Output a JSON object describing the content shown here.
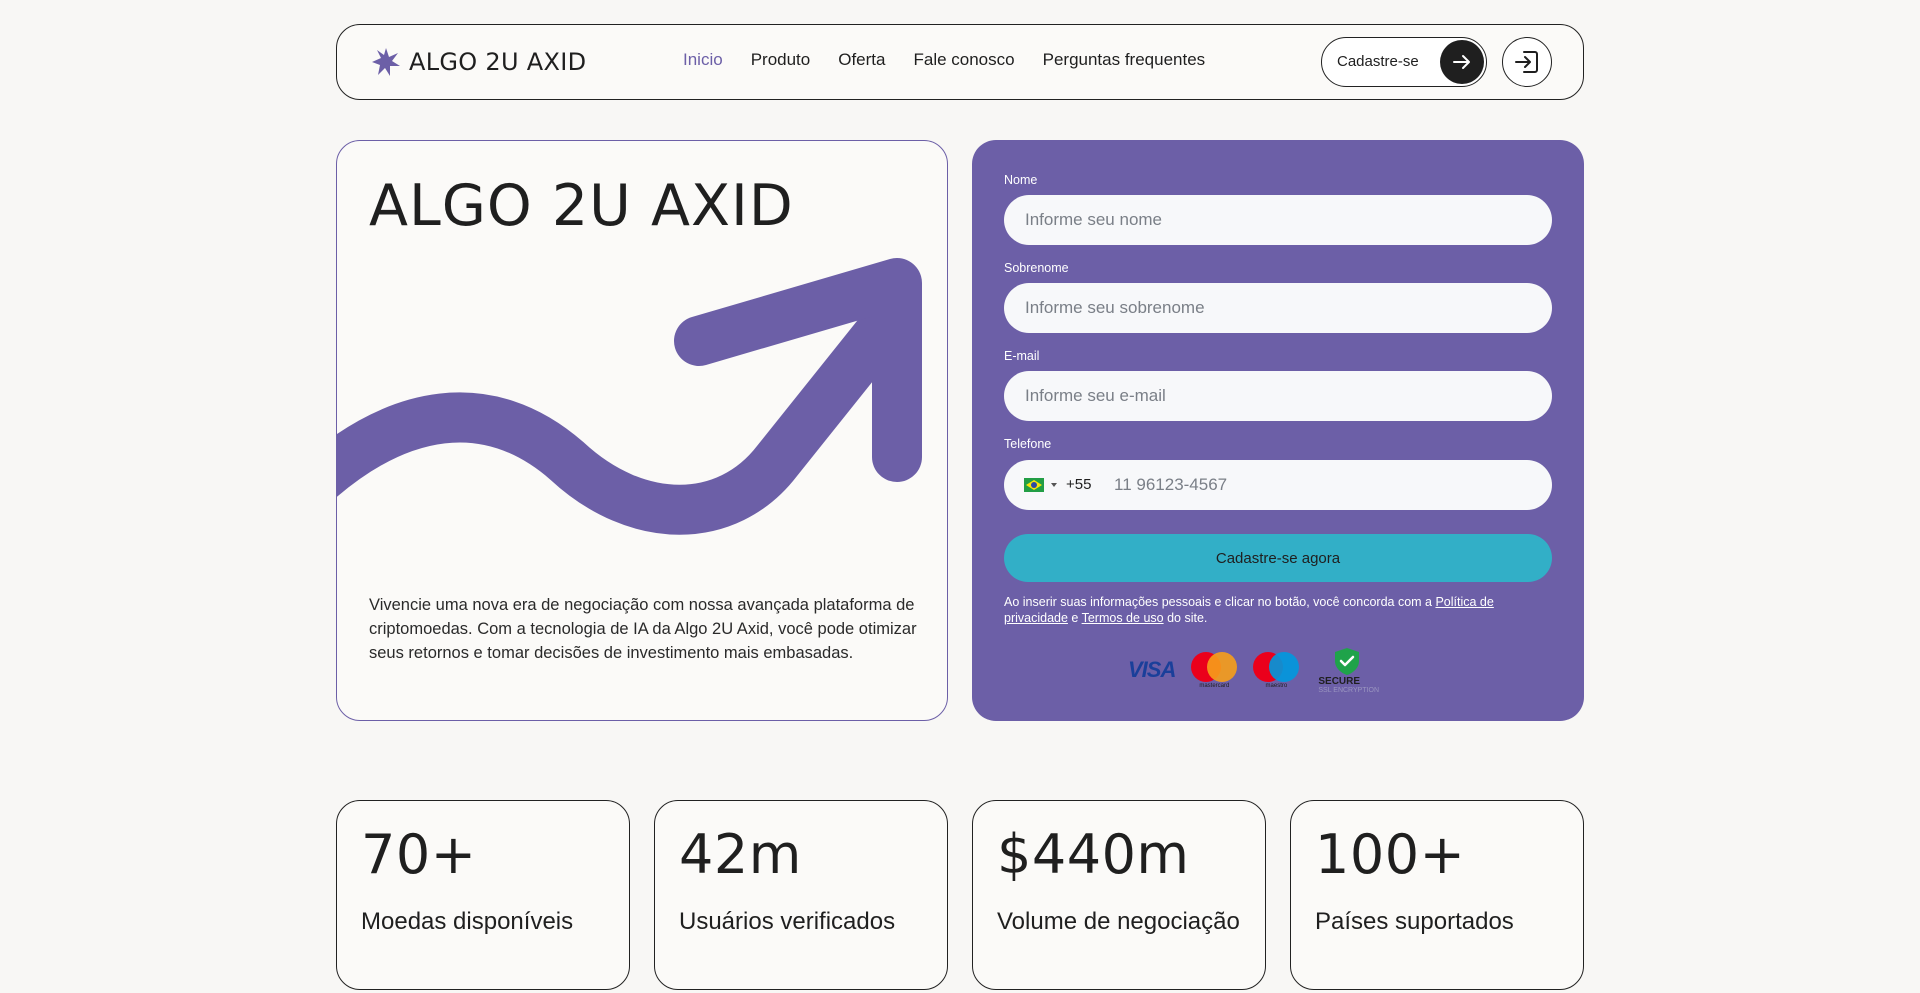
{
  "brand": {
    "name": "ALGO 2U AXID",
    "accent": "#6c5fa7"
  },
  "nav": {
    "links": [
      {
        "label": "Inicio",
        "active": true
      },
      {
        "label": "Produto",
        "active": false
      },
      {
        "label": "Oferta",
        "active": false
      },
      {
        "label": "Fale conosco",
        "active": false
      },
      {
        "label": "Perguntas frequentes",
        "active": false
      }
    ],
    "signup_label": "Cadastre-se",
    "arrow_icon": "arrow-right-icon",
    "login_icon": "login-icon"
  },
  "hero": {
    "title": "ALGO 2U AXID",
    "description": "Vivencie uma nova era de negociação com nossa avançada plataforma de criptomoedas. Com a tecnologia de IA da Algo 2U Axid, você pode otimizar seus retornos e tomar decisões de investimento mais embasadas."
  },
  "form": {
    "first_name": {
      "label": "Nome",
      "placeholder": "Informe seu nome"
    },
    "last_name": {
      "label": "Sobrenome",
      "placeholder": "Informe seu sobrenome"
    },
    "email": {
      "label": "E-mail",
      "placeholder": "Informe seu e-mail"
    },
    "phone": {
      "label": "Telefone",
      "dial_code": "+55",
      "placeholder": "11 96123-4567",
      "flag_icon": "brazil-flag-icon"
    },
    "submit_label": "Cadastre-se agora",
    "submit_color": "#32afc7",
    "disclaimer": {
      "prefix": "Ao inserir suas informações pessoais e clicar no botão, você concorda com a ",
      "privacy_link": "Política de privacidade",
      "middle": " e ",
      "terms_link": "Termos de uso",
      "suffix": " do site."
    },
    "payments": {
      "visa": "VISA",
      "mastercard": "mastercard",
      "maestro": "maestro",
      "secure_title": "SECURE",
      "secure_sub": "SSL ENCRYPTION"
    }
  },
  "stats": [
    {
      "value": "70+",
      "label": "Moedas disponíveis"
    },
    {
      "value": "42m",
      "label": "Usuários verificados"
    },
    {
      "value": "$440m",
      "label": "Volume de negociação"
    },
    {
      "value": "100+",
      "label": "Países suportados"
    }
  ]
}
